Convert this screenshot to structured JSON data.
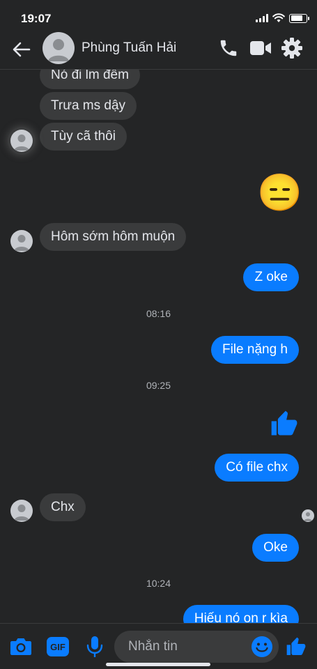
{
  "status_bar": {
    "time": "19:07",
    "battery_level": 0.8
  },
  "header": {
    "contact_name": "Phùng Tuấn Hải",
    "icons": [
      "back-arrow-icon",
      "phone-icon",
      "video-camera-icon",
      "gear-icon"
    ]
  },
  "messages": [
    {
      "side": "in",
      "text": "Nó đi lm đêm"
    },
    {
      "side": "in",
      "text": "Trưa ms dậy"
    },
    {
      "side": "in",
      "text": "Tùy cã thôi"
    },
    {
      "side": "out",
      "emoji": "😑"
    },
    {
      "side": "in",
      "text": "Hôm sớm hôm muộn"
    },
    {
      "side": "out",
      "text": "Z oke"
    },
    {
      "timestamp": "08:16"
    },
    {
      "side": "out",
      "text": "File nặng h"
    },
    {
      "timestamp": "09:25"
    },
    {
      "side": "out",
      "sticker": "thumbs-up-icon"
    },
    {
      "side": "out",
      "text": "Có file chx"
    },
    {
      "side": "in",
      "text": "Chx"
    },
    {
      "side": "out",
      "text": "Oke"
    },
    {
      "timestamp": "10:24"
    },
    {
      "side": "out",
      "text": "Hiếu nó on r kìa"
    }
  ],
  "composer": {
    "placeholder": "Nhắn tin",
    "gif_label": "GIF",
    "icons": [
      "camera-icon",
      "gif-icon",
      "microphone-icon",
      "emoji-icon",
      "thumbs-up-icon"
    ]
  },
  "colors": {
    "accent": "#0a7cff",
    "background": "#242526",
    "incoming_bubble": "#3a3b3c"
  }
}
